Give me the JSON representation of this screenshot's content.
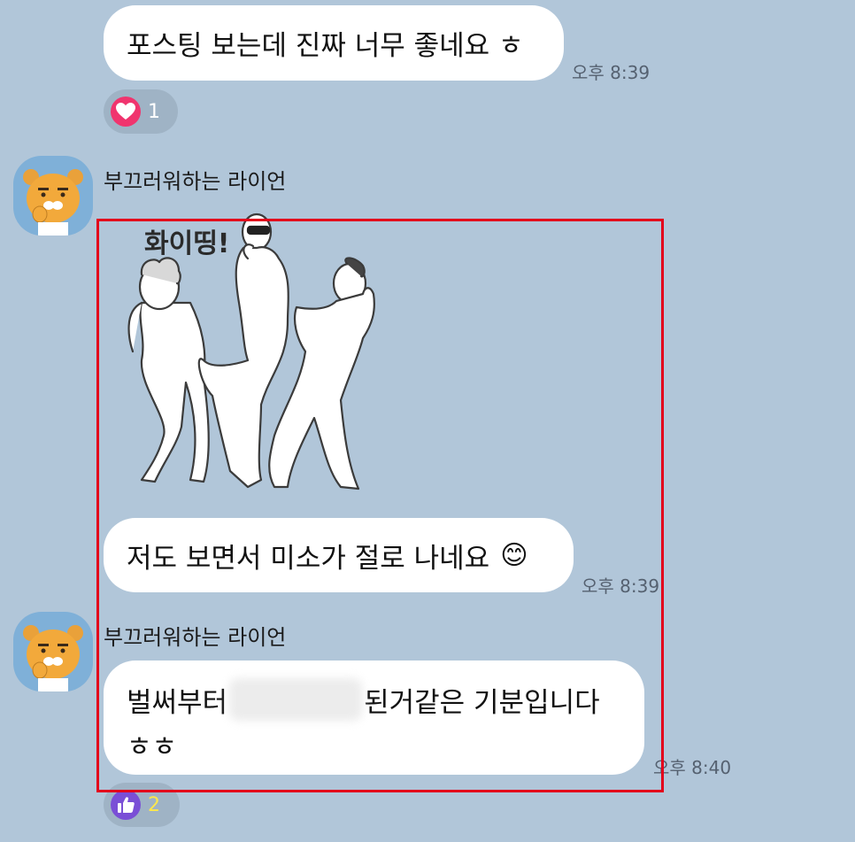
{
  "messages": [
    {
      "text": "포스팅 보는데 진짜 너무 좋네요 ㅎ",
      "time": "오후 8:39"
    },
    {
      "text": "저도 보면서 미소가 절로 나네요",
      "time": "오후 8:39",
      "emoji": "😊"
    },
    {
      "text_before": "벌써부터",
      "text_after": "된거같은 기분입니다",
      "line2": "ㅎㅎ",
      "time": "오후 8:40"
    }
  ],
  "senders": [
    "부끄러워하는 라이언",
    "부끄러워하는 라이언"
  ],
  "reactions": [
    {
      "icon": "heart-icon",
      "count": "1",
      "color": "#f0346e"
    },
    {
      "icon": "thumbs-up-icon",
      "count": "2",
      "color": "#7a4fd6",
      "count_color": "#ffe84a"
    }
  ],
  "sticker": {
    "caption": "화이띵!"
  },
  "colors": {
    "background": "#b1c6d9",
    "highlight": "#e3001b"
  }
}
